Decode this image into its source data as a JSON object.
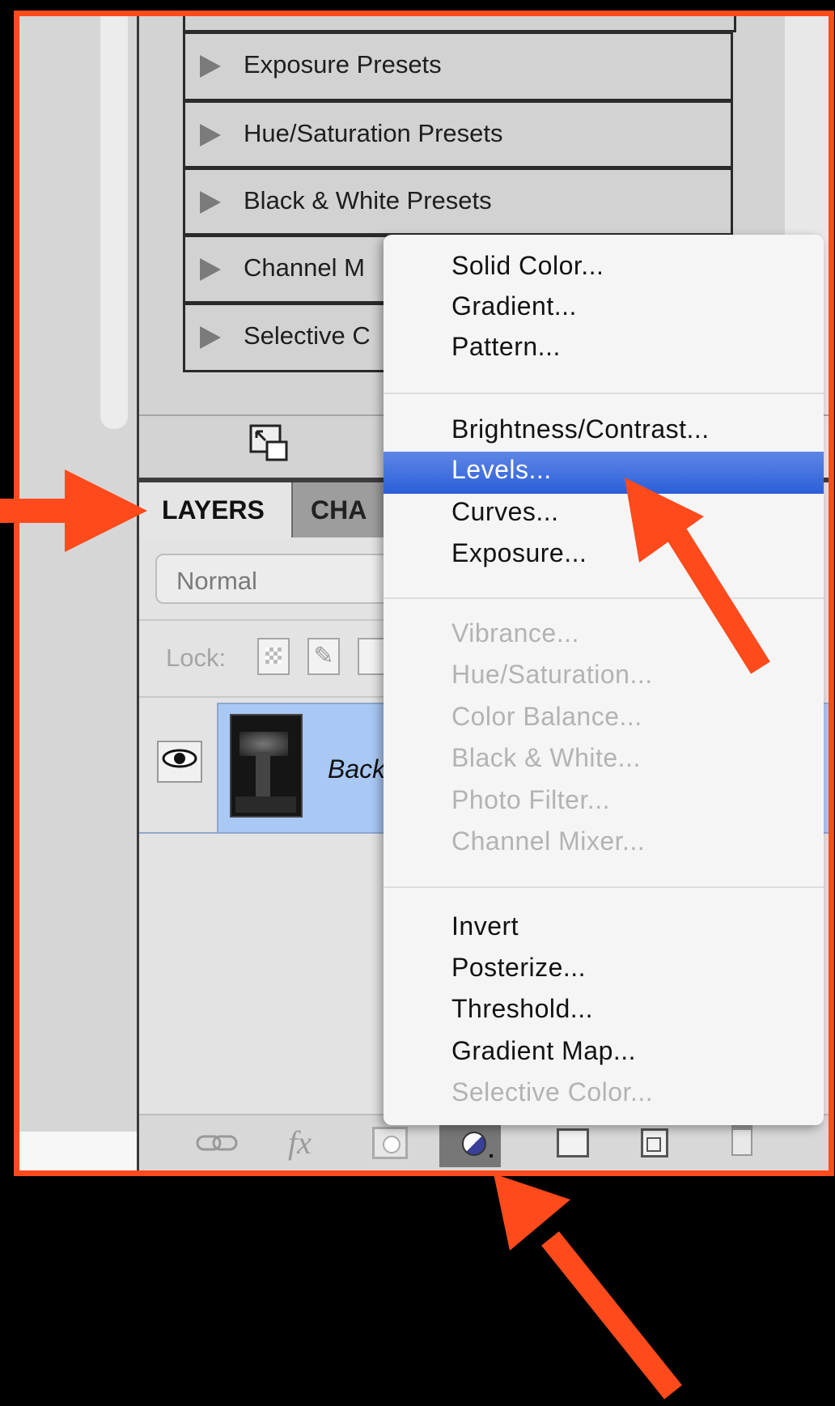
{
  "presets": [
    {
      "label": "Exposure Presets"
    },
    {
      "label": "Hue/Saturation Presets"
    },
    {
      "label": "Black & White Presets"
    },
    {
      "label": "Channel M"
    },
    {
      "label": "Selective C"
    }
  ],
  "tabs": {
    "layers": "LAYERS",
    "channels": "CHA"
  },
  "layers_panel": {
    "blend_mode": "Normal",
    "lock_label": "Lock:",
    "layer_name": "Back"
  },
  "menu": {
    "group1": [
      "Solid Color...",
      "Gradient...",
      "Pattern..."
    ],
    "group2": [
      "Brightness/Contrast...",
      "Levels...",
      "Curves...",
      "Exposure..."
    ],
    "group3_disabled": [
      "Vibrance...",
      "Hue/Saturation...",
      "Color Balance...",
      "Black & White...",
      "Photo Filter...",
      "Channel Mixer..."
    ],
    "group4": [
      "Invert",
      "Posterize...",
      "Threshold...",
      "Gradient Map..."
    ],
    "group4_disabled": [
      "Selective Color..."
    ],
    "selected": "Levels..."
  },
  "toolbar": {
    "fx_label": "fx"
  },
  "colors": {
    "frame": "#ff4a1c",
    "arrow": "#ff4a1c",
    "highlight": "#2a5fd8",
    "layer_selected": "#a9c8f4"
  }
}
